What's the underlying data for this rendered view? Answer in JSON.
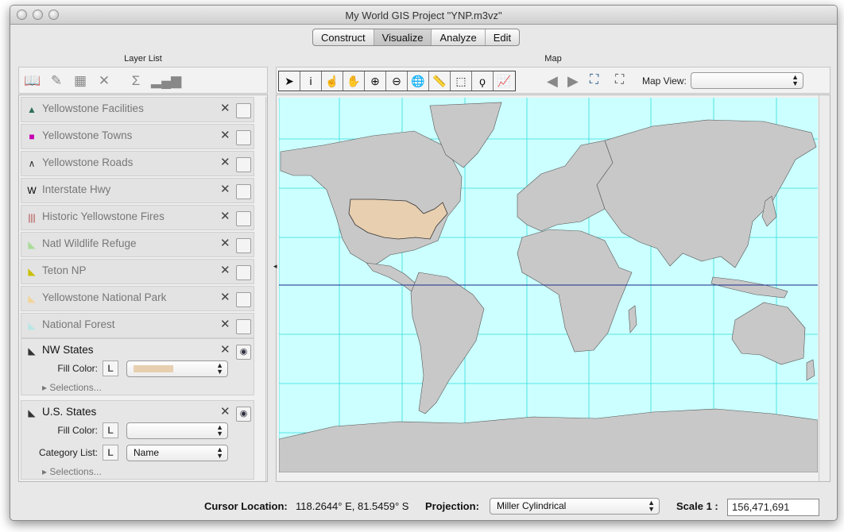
{
  "window": {
    "title": "My World GIS Project \"YNP.m3vz\""
  },
  "mode_tabs": [
    {
      "label": "Construct",
      "active": false
    },
    {
      "label": "Visualize",
      "active": true
    },
    {
      "label": "Analyze",
      "active": false
    },
    {
      "label": "Edit",
      "active": false
    }
  ],
  "layer_panel": {
    "title": "Layer List",
    "toolbar": [
      "open-layer-icon",
      "edit-layer-icon",
      "table-icon",
      "remove-layer-icon",
      "summation-icon",
      "histogram-icon"
    ],
    "layers": [
      {
        "name": "Yellowstone Facilities",
        "symbol": "▲",
        "symbol_color": "#2f6f55"
      },
      {
        "name": "Yellowstone Towns",
        "symbol": "■",
        "symbol_color": "#c400b0"
      },
      {
        "name": "Yellowstone Roads",
        "symbol": "∧",
        "symbol_color": "#333333"
      },
      {
        "name": "Interstate Hwy",
        "symbol": "W",
        "symbol_color": "#000000"
      },
      {
        "name": "Historic Yellowstone Fires",
        "symbol": "|||",
        "symbol_color": "#b04040"
      },
      {
        "name": "Natl Wildlife Refuge",
        "symbol": "◣",
        "symbol_color": "#a8dc9a"
      },
      {
        "name": "Teton NP",
        "symbol": "◣",
        "symbol_color": "#c8c000"
      },
      {
        "name": "Yellowstone National Park",
        "symbol": "◣",
        "symbol_color": "#f2d49a"
      },
      {
        "name": "National Forest",
        "symbol": "◣",
        "symbol_color": "#b8e6e6"
      }
    ],
    "expanded_layers": [
      {
        "name": "NW States",
        "fill_color_label": "Fill Color:",
        "fill_color": "#e7cfb0",
        "selections_label": "Selections..."
      },
      {
        "name": "U.S. States",
        "fill_color_label": "Fill Color:",
        "fill_color": "#f2f2f2",
        "category_list_label": "Category List:",
        "category_value": "Name",
        "selections_label": "Selections..."
      }
    ]
  },
  "map_panel": {
    "title": "Map",
    "tools": [
      "pointer-icon",
      "info-icon",
      "select-hand-icon",
      "pan-hand-icon",
      "zoom-in-icon",
      "zoom-out-icon",
      "globe-icon",
      "measure-icon",
      "box-select-icon",
      "lasso-icon",
      "chart-icon"
    ],
    "map_view_label": "Map View:",
    "map_view_value": "",
    "colors": {
      "ocean": "#ccffff",
      "land": "#c8c8c8",
      "grid": "#33dddd",
      "highlight": "#e7cfb0",
      "equator": "#1a2a8a"
    }
  },
  "status_bar": {
    "cursor_label": "Cursor Location:",
    "cursor_value": "118.2644° E, 81.5459° S",
    "projection_label": "Projection:",
    "projection_value": "Miller Cylindrical",
    "scale_label": "Scale 1 :",
    "scale_value": "156,471,691"
  }
}
